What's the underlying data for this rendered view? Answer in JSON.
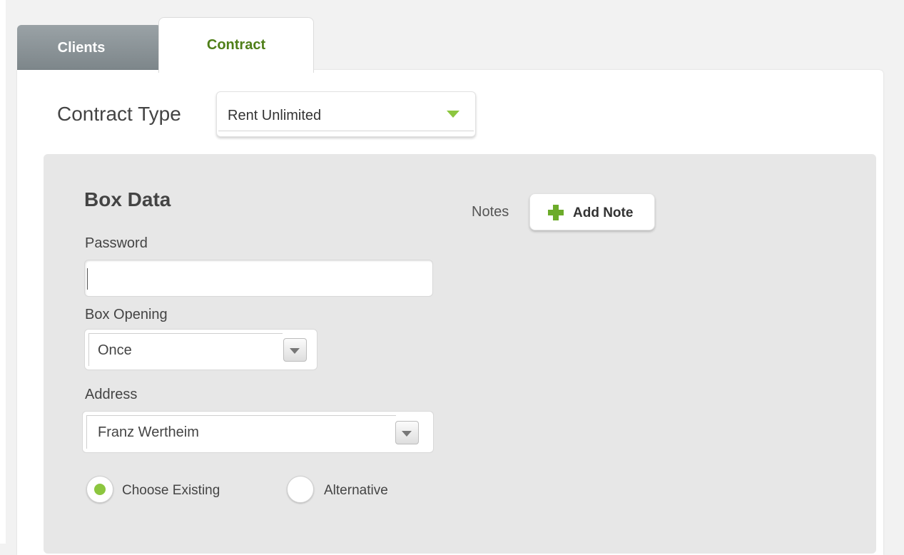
{
  "tabs": [
    {
      "label": "Clients",
      "active": false
    },
    {
      "label": "Contract",
      "active": true
    }
  ],
  "contract_type": {
    "label": "Contract Type",
    "value": "Rent Unlimited"
  },
  "box_data": {
    "title": "Box Data",
    "password": {
      "label": "Password",
      "value": ""
    },
    "box_opening": {
      "label": "Box Opening",
      "value": "Once"
    },
    "address": {
      "label": "Address",
      "value": "Franz Wertheim"
    },
    "address_mode": {
      "options": [
        {
          "label": "Choose Existing",
          "selected": true
        },
        {
          "label": "Alternative",
          "selected": false
        }
      ]
    }
  },
  "notes": {
    "label": "Notes",
    "add_button_label": "Add Note",
    "add_button_icon": "plus-icon"
  },
  "colors": {
    "accent_green": "#8cc63f",
    "active_tab_text": "#4f7f18",
    "inactive_tab_bg": "#8a9296",
    "box_background": "#e7e7e7"
  }
}
